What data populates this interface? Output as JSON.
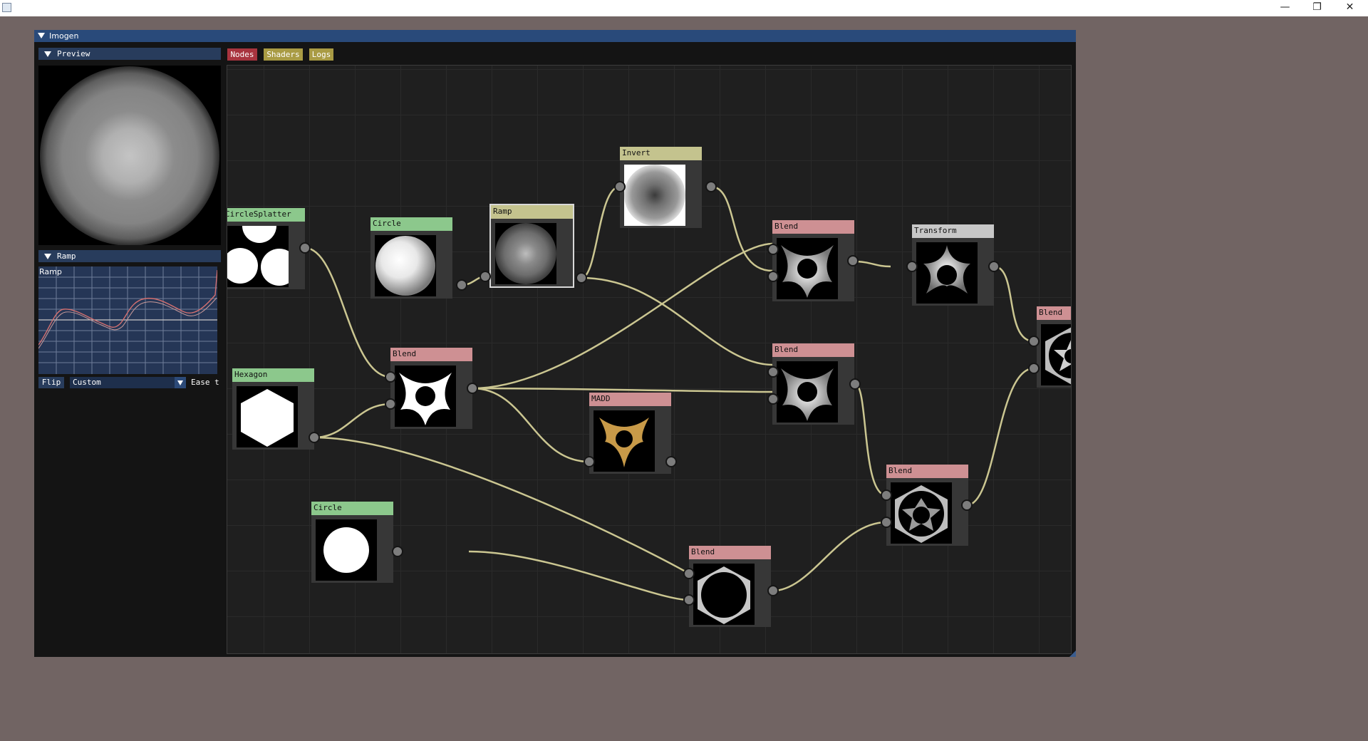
{
  "os": {
    "minimize": "—",
    "restore": "❐",
    "close": "✕"
  },
  "window": {
    "title": "Imogen"
  },
  "left_panel": {
    "preview_title": "Preview",
    "ramp_title": "Ramp",
    "ramp_plot_label": "Ramp",
    "flip_label": "Flip",
    "ramp_mode": "Custom",
    "ease_label": "Ease t"
  },
  "tabs": {
    "nodes": "Nodes",
    "shaders": "Shaders",
    "logs": "Logs"
  },
  "nodes": {
    "circlesplatter": "CircleSplatter",
    "circle1": "Circle",
    "ramp": "Ramp",
    "invert": "Invert",
    "hexagon": "Hexagon",
    "blend1": "Blend",
    "madd": "MADD",
    "circle2": "Circle",
    "blend_mid": "Blend",
    "blend_bottom": "Blend",
    "blend_top": "Blend",
    "transform": "Transform",
    "blend_lower_right": "Blend",
    "blend_far_right": "Blend"
  },
  "colors": {
    "generator_header": "#8cc88c",
    "blend_header": "#ce9093",
    "filter_header": "#c4c38e",
    "transform_header": "#c7c7c7",
    "link": "#cbc691",
    "window_title": "#294a7a"
  }
}
